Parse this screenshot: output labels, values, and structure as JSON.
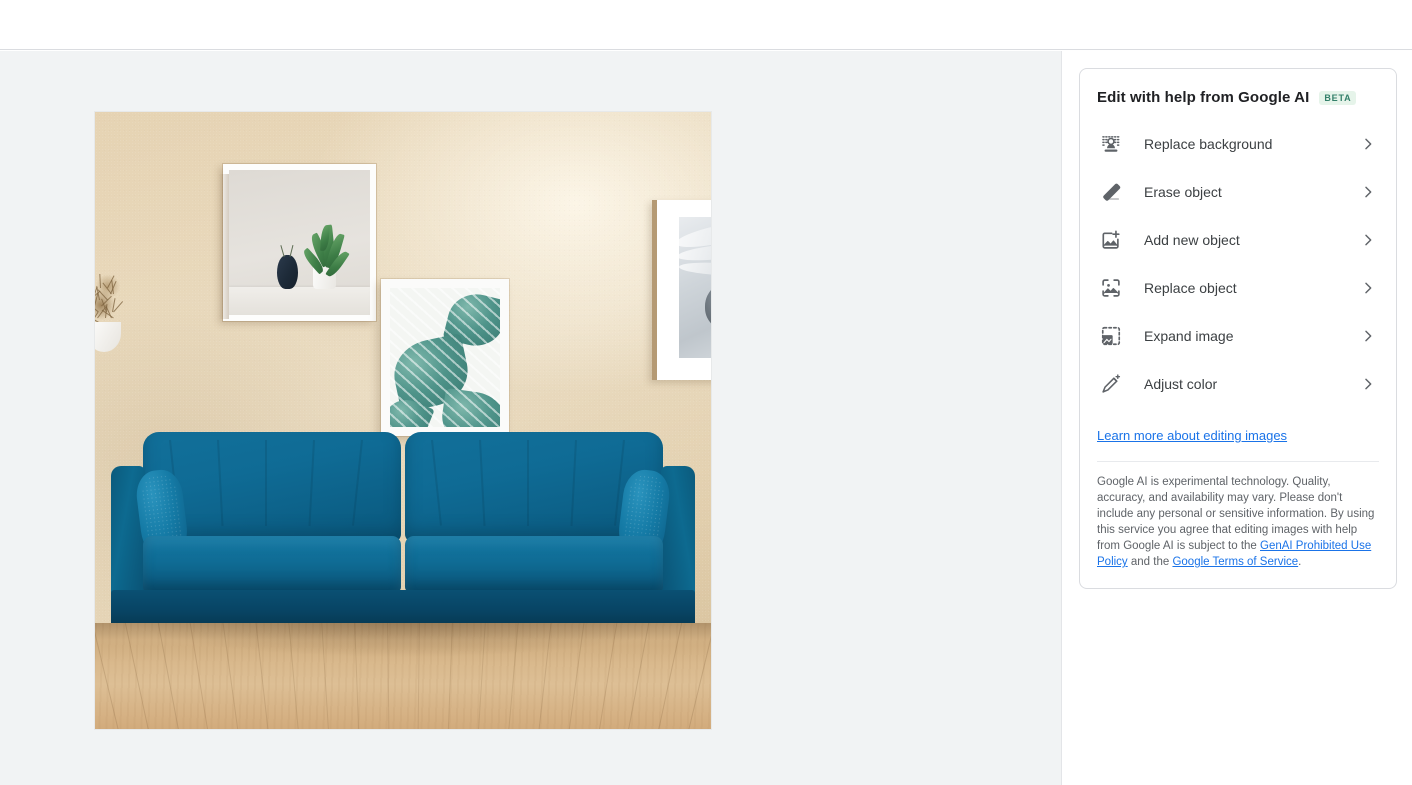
{
  "app": {
    "topbar_label": ""
  },
  "canvas": {
    "image_alt": "Living room with teal blue sofa, wooden floor and three framed wall prints",
    "image_width": "616",
    "image_height": "617",
    "background_color": "#f1f3f4"
  },
  "panel": {
    "title": "Edit with help from Google AI",
    "badge": "BETA",
    "badge_bg": "#e6f4ea",
    "badge_fg": "#34806a",
    "accent_link_color": "#1a73e8",
    "items": [
      {
        "label": "Replace background",
        "icon": "replace-background-icon",
        "chevron": "chevron-right-icon"
      },
      {
        "label": "Erase object",
        "icon": "eraser-icon",
        "chevron": "chevron-right-icon"
      },
      {
        "label": "Add new object",
        "icon": "add-image-icon",
        "chevron": "chevron-right-icon"
      },
      {
        "label": "Replace object",
        "icon": "replace-image-icon",
        "chevron": "chevron-right-icon"
      },
      {
        "label": "Expand image",
        "icon": "expand-image-icon",
        "chevron": "chevron-right-icon"
      },
      {
        "label": "Adjust color",
        "icon": "magic-wand-icon",
        "chevron": "chevron-right-icon"
      }
    ],
    "learn_more": "Learn more about editing images",
    "disclaimer": {
      "part1": "Google AI is experimental technology. Quality, accuracy, and availability may vary. Please don't include any personal or sensitive information. By using this service you agree that editing images with help from Google AI is subject to the ",
      "link1": "GenAI Prohibited Use Policy",
      "part2": " and the ",
      "link2": "Google Terms of Service",
      "part3": "."
    }
  }
}
